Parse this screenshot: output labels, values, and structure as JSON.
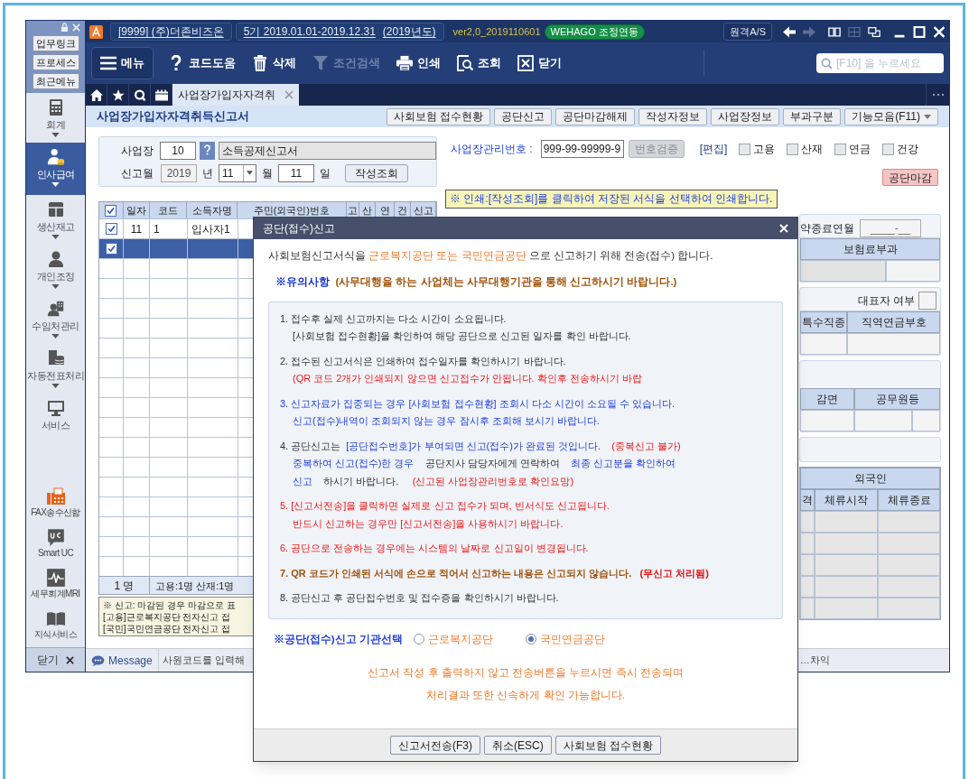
{
  "app": {
    "company": "[9999] (주)더존비즈온",
    "period": "5기 2019.01.01-2019.12.31",
    "year": "(2019년도)",
    "version": "ver2,0_2019110601",
    "badge": "WEHAGO 조정연동",
    "remote": "원격A/S"
  },
  "sidebar": {
    "links": [
      "업무링크",
      "프로세스",
      "최근메뉴"
    ],
    "modules": [
      {
        "label": "회계",
        "selected": false,
        "has_menu": true
      },
      {
        "label": "인사급여",
        "selected": true,
        "has_menu": true
      },
      {
        "label": "생산재고",
        "selected": false,
        "has_menu": true
      },
      {
        "label": "개인조정",
        "selected": false,
        "has_menu": true
      },
      {
        "label": "수임처관리",
        "selected": false,
        "has_menu": true
      },
      {
        "label": "자동전표처리",
        "selected": false,
        "has_menu": true
      },
      {
        "label": "서비스",
        "selected": false,
        "has_menu": false
      }
    ],
    "services": [
      "FAX송수신함",
      "Smart UC",
      "세무회계MRI",
      "지식서비스"
    ],
    "close": "닫기"
  },
  "toolbar": {
    "items": [
      {
        "label": "메뉴",
        "disabled": false
      },
      {
        "label": "코드도움",
        "disabled": false
      },
      {
        "label": "삭제",
        "disabled": false
      },
      {
        "label": "조건검색",
        "disabled": true
      },
      {
        "label": "인쇄",
        "disabled": false
      },
      {
        "label": "조회",
        "disabled": false
      },
      {
        "label": "닫기",
        "disabled": false
      }
    ],
    "search": {
      "placeholder": "[F10] 을 누르세요"
    }
  },
  "tabs": [
    {
      "label": "사업장가입자자격취",
      "selected": true
    }
  ],
  "page": {
    "title": "사업장가입자자격취득신고서",
    "buttons": [
      {
        "label": "사회보험 접수현황",
        "kind": "plain"
      },
      {
        "label": "공단신고",
        "kind": "plain"
      },
      {
        "label": "공단마감해제",
        "kind": "plain"
      },
      {
        "label": "작성자정보",
        "kind": "plain"
      },
      {
        "label": "사업장정보",
        "kind": "plain"
      },
      {
        "label": "부과구분",
        "kind": "plain"
      },
      {
        "label": "기능모음(F11)",
        "kind": "dropdown"
      }
    ]
  },
  "filter": {
    "workplace_label": "사업장",
    "workplace_code": "10",
    "workplace_name": "소득공제신고서",
    "month_label": "신고월",
    "year": "2019",
    "year_unit": "년",
    "month": "11",
    "month_unit": "월",
    "day": "11",
    "day_unit": "일",
    "query_button": "작성조회"
  },
  "grid": {
    "header_checked": true,
    "columns": [
      "일자",
      "코드",
      "소득자명",
      "주민(외국인)번호",
      "고",
      "산",
      "연",
      "건",
      "신고"
    ],
    "rows": [
      {
        "checked": true,
        "selected": false,
        "cells": [
          "11",
          "1",
          "입사자1"
        ]
      },
      {
        "checked": true,
        "selected": true
      }
    ],
    "footer": [
      "1 명",
      "고용:1명 산재:1명"
    ],
    "notes": [
      "※ 신고: 마감된 경우 마감으로 표",
      "[고용]근로복지공단 전자신고 접",
      "[국민]국민연금공단 전자신고 접"
    ]
  },
  "registration": {
    "label": "사업장관리번호 :",
    "value": "999-99-99999-9",
    "verify_button": "번호검증",
    "verify_disabled": true,
    "edit_link": "[편집]",
    "insurances": [
      {
        "label": "고용",
        "checked": false
      },
      {
        "label": "산재",
        "checked": false
      },
      {
        "label": "연금",
        "checked": false
      },
      {
        "label": "건강",
        "checked": false
      }
    ],
    "close_button": "공단마감",
    "print_hint": "※ 인쇄:[작성조회]를 클릭하여 저장된 서식을 선택하여 인쇄합니다."
  },
  "detail_panel": {
    "contract_end_label": "약종료연월",
    "contract_end_value": "____-__",
    "premium_header": "보험료부과",
    "representative_label": "대표자 여부",
    "representative_checked": false,
    "job_headers": [
      "특수직종",
      "직역연금부호"
    ],
    "reduction_headers": [
      "감면",
      "공무원등"
    ],
    "foreigner_header": "외국인",
    "foreigner_columns": [
      "격",
      "체류시작",
      "체류종료"
    ]
  },
  "message_bar": {
    "tab": "Message",
    "text": "사원코드를 입력해",
    "right_text": "…차익"
  },
  "dialog": {
    "title": "공단(접수)신고",
    "intro": [
      {
        "text": "사회보험신고서식을 ",
        "kind": "dark"
      },
      {
        "text": "근로복지공단 또는 국민연금공단",
        "kind": "orange"
      },
      {
        "text": " 으로 신고하기 위해 전송(접수) 합니다.",
        "kind": "dark"
      }
    ],
    "caution": [
      {
        "text": "※유의사항  ",
        "kind": "navy_bold"
      },
      {
        "text": "(사무대행을 하는 사업체는 사무대행기관을 통해 신고하시기 바랍니다.)",
        "kind": "brown_bold"
      }
    ],
    "notices": [
      {
        "lines": [
          [
            {
              "text": "1. 접수후 실제 신고까지는 다소 시간이 소요됩니다.",
              "kind": "dark"
            }
          ],
          [
            {
              "text": "[사회보험 접수현황]을 확인하여 해당 공단으로 신고된 일자를 확인 바랍니다.",
              "kind": "dark"
            }
          ]
        ]
      },
      {
        "lines": [
          [
            {
              "text": "2. 접수된 신고서식은 인쇄하여 접수일자를 확인하시기 바랍니다.",
              "kind": "dark"
            }
          ],
          [
            {
              "text": "(QR 코드 2개가 인쇄되지 않으면 신고접수가 안됩니다. 확인후 전송하시기 바랍",
              "kind": "red"
            }
          ]
        ]
      },
      {
        "lines": [
          [
            {
              "text": "3. 신고자료가 집중되는 경우 [사회보험 접수현황] 조회시 다소 시간이 소요될 수 있습니다.",
              "kind": "blue"
            }
          ],
          [
            {
              "text": "신고(접수)내역이 조회되지 않는 경우 잠시후 조회해 보시기 바랍니다.",
              "kind": "blue"
            }
          ]
        ]
      },
      {
        "lines": [
          [
            {
              "text": "4. 공단신고는  ",
              "kind": "dark"
            },
            {
              "text": "[공단접수번호]가 부여되면 신고(접수)가 완료된 것입니다.",
              "kind": "blue"
            },
            {
              "text": "    (중복신고 불가)",
              "kind": "red"
            }
          ],
          [
            {
              "text": "중복하여 신고(접수)한 경우    ",
              "kind": "blue"
            },
            {
              "text": "공단지사 담당자에게 연락하여    ",
              "kind": "dark"
            },
            {
              "text": "최종 신고분을 확인하여",
              "kind": "blue"
            }
          ],
          [
            {
              "text": "신고    ",
              "kind": "blue"
            },
            {
              "text": "하시기 바랍니다.     ",
              "kind": "dark"
            },
            {
              "text": "(신고된 사업장관리번호로 확인요망)",
              "kind": "red"
            }
          ]
        ]
      },
      {
        "lines": [
          [
            {
              "text": "5. [신고서전송]을 클릭하면 실제로 신고 접수가 되며, 빈서식도 신고됩니다.",
              "kind": "red"
            }
          ],
          [
            {
              "text": "반드시 신고하는 경우만 [신고서전송]을 사용하시기 바랍니다.",
              "kind": "red"
            }
          ]
        ]
      },
      {
        "lines": [
          [
            {
              "text": "6. 공단으로 전송하는 경우에는 시스템의 날짜로 신고일이 변경됩니다.",
              "kind": "red"
            }
          ]
        ]
      },
      {
        "lines": [
          [
            {
              "text": "7. QR 코드가 인쇄된 서식에 손으로 적어서 신고하는 내용은 신고되지 않습니다.   ",
              "kind": "brown_bold"
            },
            {
              "text": "(무신고 처리됨)",
              "kind": "red_bold"
            }
          ]
        ]
      },
      {
        "lines": [
          [
            {
              "text": "8. 공단신고 후 공단접수번호 및 접수증을 확인하시기 바랍니다.",
              "kind": "dark"
            }
          ]
        ]
      }
    ],
    "agency_label": "※공단(접수)신고 기관선택",
    "agencies": [
      {
        "label": "근로복지공단",
        "selected": false
      },
      {
        "label": "국민연금공단",
        "selected": true
      }
    ],
    "footer_message": [
      "신고서 작성 후 출력하지 않고 전송버튼을 누르시면 즉시 전송되며",
      "처리결과 또한 신속하게 확인 가능합니다."
    ],
    "buttons": [
      "신고서전송(F3)",
      "취소(ESC)",
      "사회보험 접수현황"
    ]
  }
}
